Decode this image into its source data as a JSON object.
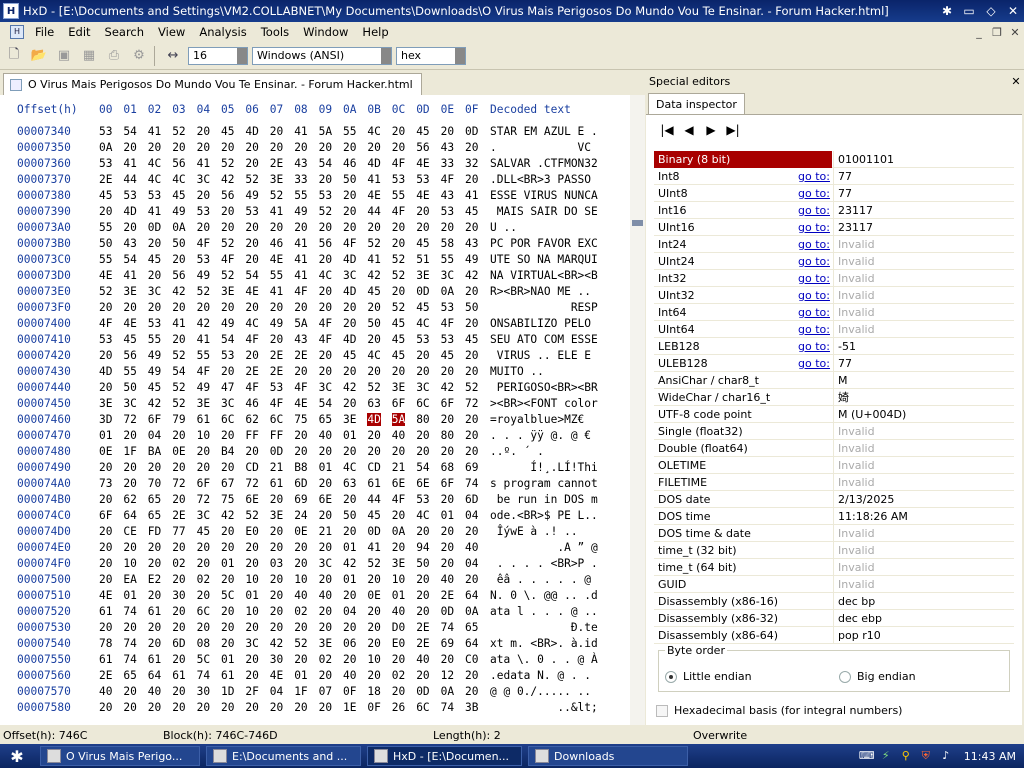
{
  "window": {
    "title": "HxD - [E:\\Documents and Settings\\VM2.COLLABNET\\My Documents\\Downloads\\O Virus Mais Perigosos Do Mundo Vou Te Ensinar. - Forum Hacker.html]"
  },
  "menu": [
    "File",
    "Edit",
    "Search",
    "View",
    "Analysis",
    "Tools",
    "Window",
    "Help"
  ],
  "toolbar": {
    "bytes_per_row": "16",
    "charset": "Windows (ANSI)",
    "display_mode": "hex"
  },
  "tab": {
    "label": "O Virus Mais Perigosos Do Mundo Vou Te Ensinar. - Forum Hacker.html"
  },
  "hex": {
    "offset_header": "Offset(h)",
    "columns": [
      "00",
      "01",
      "02",
      "03",
      "04",
      "05",
      "06",
      "07",
      "08",
      "09",
      "0A",
      "0B",
      "0C",
      "0D",
      "0E",
      "0F"
    ],
    "decoded_header": "Decoded text",
    "rows": [
      {
        "off": "00007340",
        "hex": "53 54 41 52 20 45 4D 20 41 5A 55 4C 20 45 20 0D",
        "dec": "STAR EM AZUL E ."
      },
      {
        "off": "00007350",
        "hex": "0A 20 20 20 20 20 20 20 20 20 20 20 20 56 43 20",
        "dec": ".            VC "
      },
      {
        "off": "00007360",
        "hex": "53 41 4C 56 41 52 20 2E 43 54 46 4D 4F 4E 33 32",
        "dec": "SALVAR .CTFMON32"
      },
      {
        "off": "00007370",
        "hex": "2E 44 4C 4C 3C 42 52 3E 33 20 50 41 53 53 4F 20",
        "dec": ".DLL<BR>3 PASSO "
      },
      {
        "off": "00007380",
        "hex": "45 53 53 45 20 56 49 52 55 53 20 4E 55 4E 43 41",
        "dec": "ESSE VIRUS NUNCA"
      },
      {
        "off": "00007390",
        "hex": "20 4D 41 49 53 20 53 41 49 52 20 44 4F 20 53 45",
        "dec": " MAIS SAIR DO SE"
      },
      {
        "off": "000073A0",
        "hex": "55 20 0D 0A 20 20 20 20 20 20 20 20 20 20 20 20",
        "dec": "U ..            "
      },
      {
        "off": "000073B0",
        "hex": "50 43 20 50 4F 52 20 46 41 56 4F 52 20 45 58 43",
        "dec": "PC POR FAVOR EXC"
      },
      {
        "off": "000073C0",
        "hex": "55 54 45 20 53 4F 20 4E 41 20 4D 41 52 51 55 49",
        "dec": "UTE SO NA MARQUI"
      },
      {
        "off": "000073D0",
        "hex": "4E 41 20 56 49 52 54 55 41 4C 3C 42 52 3E 3C 42",
        "dec": "NA VIRTUAL<BR><B"
      },
      {
        "off": "000073E0",
        "hex": "52 3E 3C 42 52 3E 4E 41 4F 20 4D 45 20 0D 0A 20",
        "dec": "R><BR>NAO ME .. "
      },
      {
        "off": "000073F0",
        "hex": "20 20 20 20 20 20 20 20 20 20 20 20 52 45 53 50",
        "dec": "            RESP"
      },
      {
        "off": "00007400",
        "hex": "4F 4E 53 41 42 49 4C 49 5A 4F 20 50 45 4C 4F 20",
        "dec": "ONSABILIZO PELO "
      },
      {
        "off": "00007410",
        "hex": "53 45 55 20 41 54 4F 20 43 4F 4D 20 45 53 53 45",
        "dec": "SEU ATO COM ESSE"
      },
      {
        "off": "00007420",
        "hex": "20 56 49 52 55 53 20 2E 2E 20 45 4C 45 20 45 20",
        "dec": " VIRUS .. ELE E "
      },
      {
        "off": "00007430",
        "hex": "4D 55 49 54 4F 20 2E 2E 20 20 20 20 20 20 20 20",
        "dec": "MUITO ..        "
      },
      {
        "off": "00007440",
        "hex": "20 50 45 52 49 47 4F 53 4F 3C 42 52 3E 3C 42 52",
        "dec": " PERIGOSO<BR><BR"
      },
      {
        "off": "00007450",
        "hex": "3E 3C 42 52 3E 3C 46 4F 4E 54 20 63 6F 6C 6F 72",
        "dec": "><BR><FONT color"
      },
      {
        "off": "00007460",
        "hex": "3D 72 6F 79 61 6C 62 6C 75 65 3E 4D 5A 80 20 20",
        "dec": "=royalblue>MZ€  "
      },
      {
        "off": "00007470",
        "hex": "01 20 04 20 10 20 FF FF 20 40 01 20 40 20 80 20",
        "dec": ". . . ÿÿ @. @ € "
      },
      {
        "off": "00007480",
        "hex": "0E 1F BA 0E 20 B4 20 0D 20 20 20 20 20 20 20 20",
        "dec": "..º. ´ .        "
      },
      {
        "off": "00007490",
        "hex": "20 20 20 20 20 20 CD 21 B8 01 4C CD 21 54 68 69",
        "dec": "      Í!¸.LÍ!Thi"
      },
      {
        "off": "000074A0",
        "hex": "73 20 70 72 6F 67 72 61 6D 20 63 61 6E 6E 6F 74",
        "dec": "s program cannot"
      },
      {
        "off": "000074B0",
        "hex": "20 62 65 20 72 75 6E 20 69 6E 20 44 4F 53 20 6D",
        "dec": " be run in DOS m"
      },
      {
        "off": "000074C0",
        "hex": "6F 64 65 2E 3C 42 52 3E 24 20 50 45 20 4C 01 04",
        "dec": "ode.<BR>$ PE L.."
      },
      {
        "off": "000074D0",
        "hex": "20 CE FD 77 45 20 E0 20 0E 21 20 0D 0A 20 20 20",
        "dec": " ÎýwE à .! ..   "
      },
      {
        "off": "000074E0",
        "hex": "20 20 20 20 20 20 20 20 20 20 01 41 20 94 20 40",
        "dec": "          .A ” @"
      },
      {
        "off": "000074F0",
        "hex": "20 10 20 02 20 01 20 03 20 3C 42 52 3E 50 20 04",
        "dec": " . . . . <BR>P ."
      },
      {
        "off": "00007500",
        "hex": "20 EA E2 20 02 20 10 20 10 20 01 20 10 20 40 20",
        "dec": " êâ . . . . . @ "
      },
      {
        "off": "00007510",
        "hex": "4E 01 20 30 20 5C 01 20 40 40 20 0E 01 20 2E 64",
        "dec": "N. 0 \\. @@ .. .d"
      },
      {
        "off": "00007520",
        "hex": "61 74 61 20 6C 20 10 20 02 20 04 20 40 20 0D 0A",
        "dec": "ata l . . . @ .."
      },
      {
        "off": "00007530",
        "hex": "20 20 20 20 20 20 20 20 20 20 20 20 D0 2E 74 65",
        "dec": "            Ð.te"
      },
      {
        "off": "00007540",
        "hex": "78 74 20 6D 08 20 3C 42 52 3E 06 20 E0 2E 69 64",
        "dec": "xt m. <BR>. à.id"
      },
      {
        "off": "00007550",
        "hex": "61 74 61 20 5C 01 20 30 20 02 20 10 20 40 20 C0",
        "dec": "ata \\. 0 . . @ À"
      },
      {
        "off": "00007560",
        "hex": "2E 65 64 61 74 61 20 4E 01 20 40 20 02 20 12 20",
        "dec": ".edata N. @ . . "
      },
      {
        "off": "00007570",
        "hex": "40 20 40 20 30 1D 2F 04 1F 07 0F 18 20 0D 0A 20",
        "dec": "@ @ 0./..... .. "
      },
      {
        "off": "00007580",
        "hex": "20 20 20 20 20 20 20 20 20 20 1E 0F 26 6C 74 3B",
        "dec": "          ..&lt;"
      }
    ],
    "selection": {
      "row": 18,
      "cols": [
        11,
        12
      ]
    }
  },
  "panel": {
    "title": "Special editors",
    "tab": "Data inspector"
  },
  "inspector": {
    "nav": [
      "|◀",
      "◀",
      "▶",
      "▶|"
    ],
    "goto_label": "go to:",
    "rows": [
      {
        "name": "Binary (8 bit)",
        "value": "01001101",
        "goto": false,
        "invalid": false,
        "selected": true
      },
      {
        "name": "Int8",
        "value": "77",
        "goto": true,
        "invalid": false
      },
      {
        "name": "UInt8",
        "value": "77",
        "goto": true,
        "invalid": false
      },
      {
        "name": "Int16",
        "value": "23117",
        "goto": true,
        "invalid": false
      },
      {
        "name": "UInt16",
        "value": "23117",
        "goto": true,
        "invalid": false
      },
      {
        "name": "Int24",
        "value": "Invalid",
        "goto": true,
        "invalid": true
      },
      {
        "name": "UInt24",
        "value": "Invalid",
        "goto": true,
        "invalid": true
      },
      {
        "name": "Int32",
        "value": "Invalid",
        "goto": true,
        "invalid": true
      },
      {
        "name": "UInt32",
        "value": "Invalid",
        "goto": true,
        "invalid": true
      },
      {
        "name": "Int64",
        "value": "Invalid",
        "goto": true,
        "invalid": true
      },
      {
        "name": "UInt64",
        "value": "Invalid",
        "goto": true,
        "invalid": true
      },
      {
        "name": "LEB128",
        "value": "-51",
        "goto": true,
        "invalid": false
      },
      {
        "name": "ULEB128",
        "value": "77",
        "goto": true,
        "invalid": false
      },
      {
        "name": "AnsiChar / char8_t",
        "value": "M",
        "goto": false,
        "invalid": false
      },
      {
        "name": "WideChar / char16_t",
        "value": "婍",
        "goto": false,
        "invalid": false
      },
      {
        "name": "UTF-8 code point",
        "value": "M (U+004D)",
        "goto": false,
        "invalid": false
      },
      {
        "name": "Single (float32)",
        "value": "Invalid",
        "goto": false,
        "invalid": true
      },
      {
        "name": "Double (float64)",
        "value": "Invalid",
        "goto": false,
        "invalid": true
      },
      {
        "name": "OLETIME",
        "value": "Invalid",
        "goto": false,
        "invalid": true
      },
      {
        "name": "FILETIME",
        "value": "Invalid",
        "goto": false,
        "invalid": true
      },
      {
        "name": "DOS date",
        "value": "2/13/2025",
        "goto": false,
        "invalid": false
      },
      {
        "name": "DOS time",
        "value": "11:18:26 AM",
        "goto": false,
        "invalid": false
      },
      {
        "name": "DOS time & date",
        "value": "Invalid",
        "goto": false,
        "invalid": true
      },
      {
        "name": "time_t (32 bit)",
        "value": "Invalid",
        "goto": false,
        "invalid": true
      },
      {
        "name": "time_t (64 bit)",
        "value": "Invalid",
        "goto": false,
        "invalid": true
      },
      {
        "name": "GUID",
        "value": "Invalid",
        "goto": false,
        "invalid": true
      },
      {
        "name": "Disassembly (x86-16)",
        "value": "dec bp",
        "goto": false,
        "invalid": false
      },
      {
        "name": "Disassembly (x86-32)",
        "value": "dec ebp",
        "goto": false,
        "invalid": false
      },
      {
        "name": "Disassembly (x86-64)",
        "value": "pop r10",
        "goto": false,
        "invalid": false
      }
    ],
    "byte_order": {
      "label": "Byte order",
      "little": "Little endian",
      "big": "Big endian",
      "selected": "little"
    },
    "hex_basis": "Hexadecimal basis (for integral numbers)"
  },
  "status": {
    "offset": "Offset(h): 746C",
    "block": "Block(h): 746C-746D",
    "length": "Length(h): 2",
    "mode": "Overwrite"
  },
  "taskbar": {
    "tasks": [
      {
        "label": "O Virus Mais Perigo...",
        "icon": "browser-icon"
      },
      {
        "label": "E:\\Documents and ...",
        "icon": "archive-icon"
      },
      {
        "label": "HxD - [E:\\Documen...",
        "icon": "hxd-icon",
        "active": true
      },
      {
        "label": "Downloads",
        "icon": "folder-icon"
      }
    ],
    "clock": "11:43 AM"
  }
}
